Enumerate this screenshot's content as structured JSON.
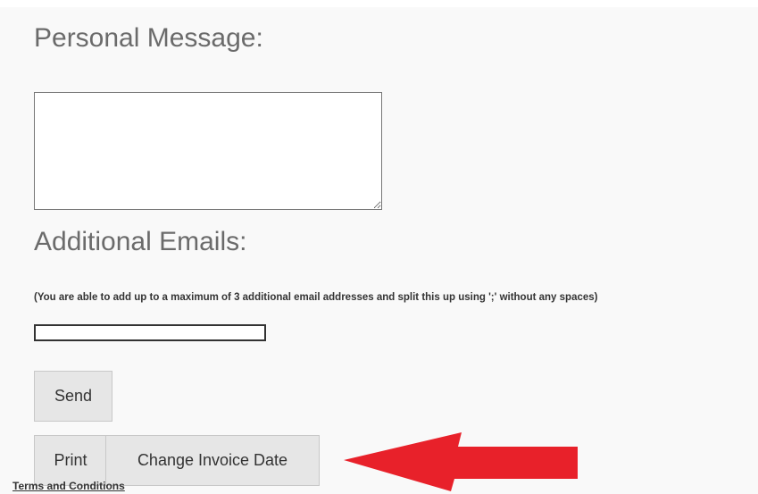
{
  "personal_message": {
    "heading": "Personal Message:",
    "value": ""
  },
  "additional_emails": {
    "heading": "Additional Emails:",
    "hint": "(You are able to add up to a maximum of 3 additional email addresses and split this up using ';' without any spaces)",
    "value": ""
  },
  "buttons": {
    "send": "Send",
    "print": "Print",
    "change_invoice_date": "Change Invoice Date"
  },
  "footer": {
    "terms_link": "Terms and Conditions"
  },
  "colors": {
    "arrow": "#e8212a",
    "heading": "#6b6b6b",
    "button_bg": "#e6e6e6"
  },
  "icons": {
    "annotation": "red-arrow-left-icon"
  }
}
